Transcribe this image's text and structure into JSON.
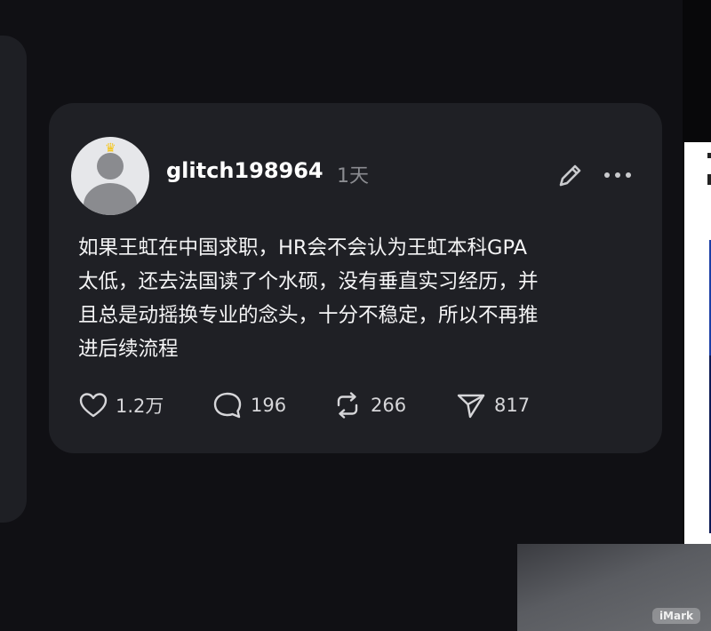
{
  "post": {
    "username": "glitch198964",
    "time": "1天",
    "text": "如果王虹在中国求职，HR会不会认为王虹本科GPA\n太低，还去法国读了个水硕，没有垂直实习经历，并\n且总是动摇换专业的念头，十分不稳定，所以不再推\n进后续流程",
    "badge_icon": "crown-icon",
    "actions": {
      "likes": "1.2万",
      "comments": "196",
      "reposts": "266",
      "shares": "817"
    }
  },
  "watermark": "iMark",
  "colors": {
    "background": "#101014",
    "card": "#1f2025",
    "text": "#f4f4f5",
    "muted": "#8b8c91"
  }
}
